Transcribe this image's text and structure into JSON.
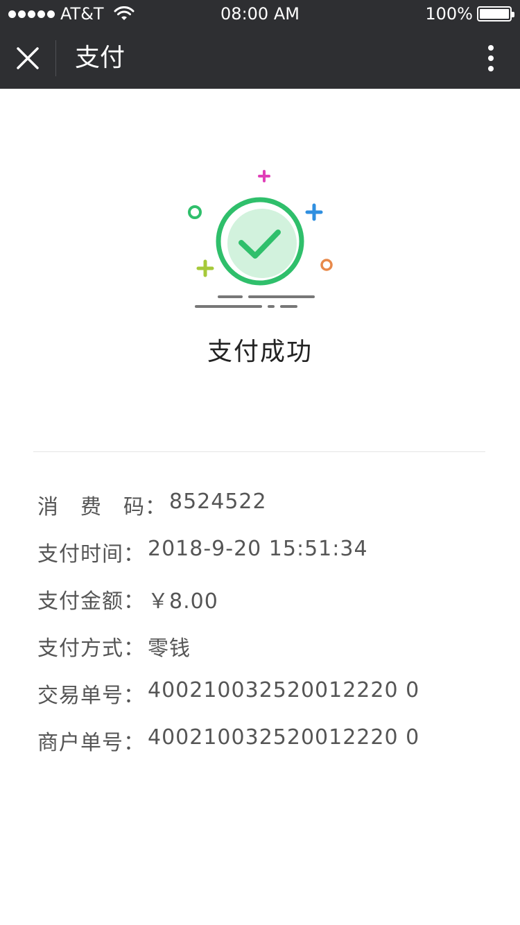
{
  "status_bar": {
    "carrier": "AT&T",
    "time": "08:00 AM",
    "battery": "100%"
  },
  "nav": {
    "title": "支付"
  },
  "result": {
    "text": "支付成功"
  },
  "details": [
    {
      "label": "消　费　码",
      "sep": "：",
      "value": "8524522"
    },
    {
      "label": "支付时间",
      "sep": "：",
      "value": "2018-9-20 15:51:34"
    },
    {
      "label": "支付金额",
      "sep": "：",
      "value": "￥8.00"
    },
    {
      "label": "支付方式",
      "sep": "：",
      "value": "零钱"
    },
    {
      "label": "交易单号",
      "sep": "：",
      "value": "400210032520012220 0"
    },
    {
      "label": "商户单号",
      "sep": "：",
      "value": "400210032520012220 0"
    }
  ],
  "colors": {
    "nav_background": "#2e2f32",
    "success_green": "#2fbf6b",
    "success_fill": "#d2f2dd"
  }
}
